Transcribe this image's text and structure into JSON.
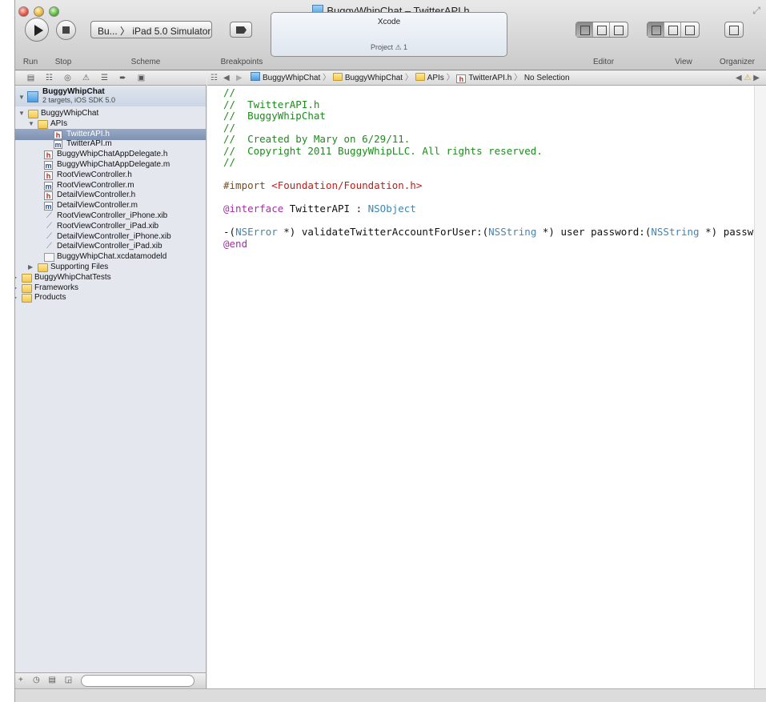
{
  "window": {
    "title": "BuggyWhipChat – TwitterAPI.h"
  },
  "toolbar": {
    "run_label": "Run",
    "stop_label": "Stop",
    "scheme_label": "Scheme",
    "scheme_value": "Bu... 〉 iPad 5.0 Simulator",
    "breakpoints_label": "Breakpoints",
    "activity_title": "Xcode",
    "activity_sub": "Project ⚠ 1",
    "editor_label": "Editor",
    "view_label": "View",
    "organizer_label": "Organizer"
  },
  "navigator": {
    "project_name": "BuggyWhipChat",
    "project_sub": "2 targets, iOS SDK 5.0",
    "items": [
      {
        "label": "BuggyWhipChat",
        "icon": "folder-icon",
        "disclosure": "open"
      },
      {
        "label": "APIs",
        "icon": "folder-icon",
        "disclosure": "open"
      },
      {
        "label": "TwitterAPI.h",
        "icon": "header-file-icon",
        "selected": true
      },
      {
        "label": "TwitterAPI.m",
        "icon": "implementation-file-icon"
      },
      {
        "label": "BuggyWhipChatAppDelegate.h",
        "icon": "header-file-icon"
      },
      {
        "label": "BuggyWhipChatAppDelegate.m",
        "icon": "implementation-file-icon"
      },
      {
        "label": "RootViewController.h",
        "icon": "header-file-icon"
      },
      {
        "label": "RootViewController.m",
        "icon": "implementation-file-icon"
      },
      {
        "label": "DetailViewController.h",
        "icon": "header-file-icon"
      },
      {
        "label": "DetailViewController.m",
        "icon": "implementation-file-icon"
      },
      {
        "label": "RootViewController_iPhone.xib",
        "icon": "xib-file-icon"
      },
      {
        "label": "RootViewController_iPad.xib",
        "icon": "xib-file-icon"
      },
      {
        "label": "DetailViewController_iPhone.xib",
        "icon": "xib-file-icon"
      },
      {
        "label": "DetailViewController_iPad.xib",
        "icon": "xib-file-icon"
      },
      {
        "label": "BuggyWhipChat.xcdatamodeld",
        "icon": "datamodel-file-icon"
      },
      {
        "label": "Supporting Files",
        "icon": "folder-icon",
        "disclosure": "closed"
      },
      {
        "label": "BuggyWhipChatTests",
        "icon": "folder-icon",
        "disclosure": "closed"
      },
      {
        "label": "Frameworks",
        "icon": "folder-icon",
        "disclosure": "closed"
      },
      {
        "label": "Products",
        "icon": "folder-icon",
        "disclosure": "closed"
      }
    ]
  },
  "jumpbar": {
    "crumb1": "BuggyWhipChat",
    "crumb2": "BuggyWhipChat",
    "crumb3": "APIs",
    "crumb4": "TwitterAPI.h",
    "crumb5": "No Selection"
  },
  "editor": {
    "lines": [
      [
        {
          "t": "//",
          "c": "c"
        }
      ],
      [
        {
          "t": "//  TwitterAPI.h",
          "c": "c"
        }
      ],
      [
        {
          "t": "//  BuggyWhipChat",
          "c": "c"
        }
      ],
      [
        {
          "t": "//",
          "c": "c"
        }
      ],
      [
        {
          "t": "//  Created by Mary on 6/29/11.",
          "c": "c"
        }
      ],
      [
        {
          "t": "//  Copyright 2011 BuggyWhipLLC. All rights reserved.",
          "c": "c"
        }
      ],
      [
        {
          "t": "//",
          "c": "c"
        }
      ],
      [],
      [
        {
          "t": "#import ",
          "c": "pp"
        },
        {
          "t": "<Foundation/Foundation.h>",
          "c": "str"
        }
      ],
      [],
      [
        {
          "t": "@interface",
          "c": "kw"
        },
        {
          "t": " TwitterAPI : ",
          "c": "pl"
        },
        {
          "t": "NSObject",
          "c": "ty"
        }
      ],
      [],
      [
        {
          "t": "-(",
          "c": "pl"
        },
        {
          "t": "NSError",
          "c": "ty"
        },
        {
          "t": " *) validateTwitterAccountForUser:(",
          "c": "pl"
        },
        {
          "t": "NSString",
          "c": "ty"
        },
        {
          "t": " *) user password:(",
          "c": "pl"
        },
        {
          "t": "NSString",
          "c": "ty"
        },
        {
          "t": " *) password;",
          "c": "pl"
        }
      ],
      [
        {
          "t": "@end",
          "c": "kw"
        }
      ]
    ]
  }
}
